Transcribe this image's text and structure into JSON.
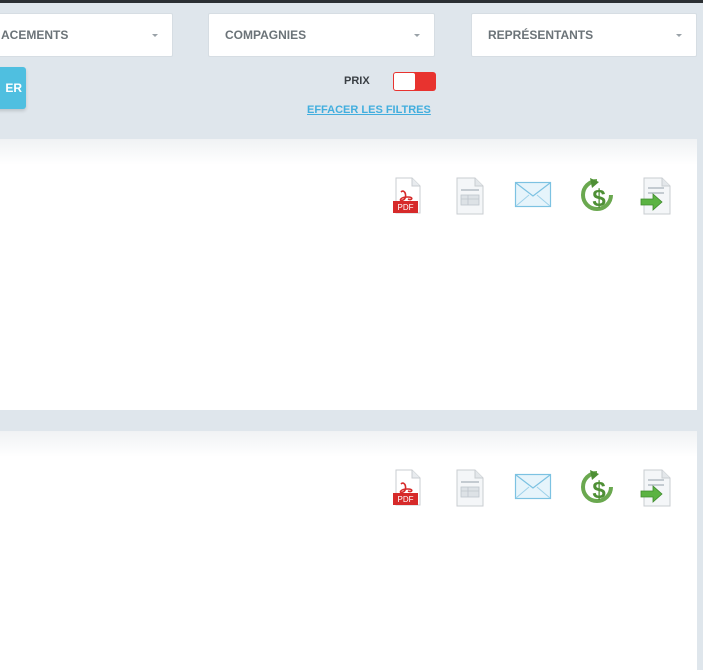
{
  "filters": {
    "emplacements_label": "ACEMENTS",
    "compagnies_label": "COMPAGNIES",
    "representants_label": "REPRÉSENTANTS",
    "search_button_label": "ER",
    "price_label": "PRIX",
    "clear_filters_label": "EFFACER LES FILTRES"
  },
  "cards": [
    {
      "icons": [
        "pdf-icon",
        "document-icon",
        "mail-icon",
        "dollar-refresh-icon",
        "export-icon"
      ]
    },
    {
      "icons": [
        "pdf-icon",
        "document-icon",
        "mail-icon",
        "dollar-refresh-icon",
        "export-icon"
      ]
    }
  ],
  "icon_labels": {
    "pdf": "PDF"
  },
  "colors": {
    "accent": "#4fbfe0",
    "link": "#42aede",
    "toggle_off": "#e8332f",
    "background": "#dfe6ec"
  },
  "price_toggle_on": false
}
